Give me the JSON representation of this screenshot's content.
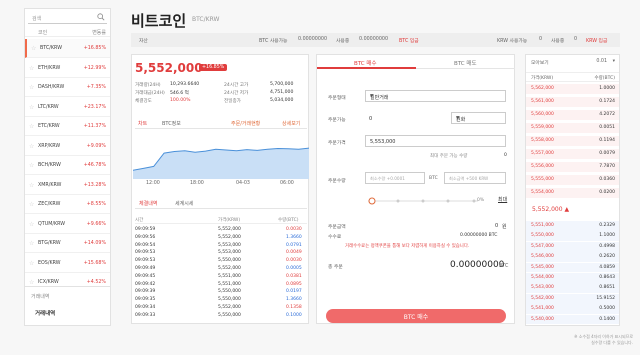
{
  "sidebar": {
    "search_placeholder": "검색",
    "col_coin": "코인",
    "col_change": "변동률",
    "coins": [
      {
        "name": "BTC/KRW",
        "change": "+16.85%"
      },
      {
        "name": "ETH/KRW",
        "change": "+12.99%"
      },
      {
        "name": "DASH/KRW",
        "change": "+7.35%"
      },
      {
        "name": "LTC/KRW",
        "change": "+23.17%"
      },
      {
        "name": "ETC/KRW",
        "change": "+11.37%"
      },
      {
        "name": "XRP/KRW",
        "change": "+9.09%"
      },
      {
        "name": "BCH/KRW",
        "change": "+46.78%"
      },
      {
        "name": "XMR/KRW",
        "change": "+13.28%"
      },
      {
        "name": "ZEC/KRW",
        "change": "+8.55%"
      },
      {
        "name": "QTUM/KRW",
        "change": "+9.66%"
      },
      {
        "name": "BTG/KRW",
        "change": "+14.09%"
      },
      {
        "name": "EOS/KRW",
        "change": "+15.68%"
      },
      {
        "name": "ICX/KRW",
        "change": "+4.52%"
      }
    ],
    "bottom_section": "거래내역",
    "bottom_link": "거래내역"
  },
  "header": {
    "title": "비트코인",
    "subtitle": "BTC/KRW"
  },
  "assets": {
    "label": "자산",
    "btc_avail_label": "BTC 사용가능",
    "btc_avail": "0.00000000",
    "btc_inuse_label": "사용중",
    "btc_inuse": "0.00000000",
    "btc_deposit": "BTC 입금",
    "krw_avail_label": "KRW 사용가능",
    "krw_avail": "0",
    "krw_inuse_label": "사용중",
    "krw_inuse": "0",
    "krw_deposit": "KRW 입금"
  },
  "ticker": {
    "price": "5,552,000",
    "change": "+16.85%",
    "stats": [
      {
        "label": "거래량(24H)",
        "value": "10,293.6640"
      },
      {
        "label": "거래대금(24H)",
        "value": "546.6 억"
      },
      {
        "label": "체결강도",
        "value": "100.00%"
      },
      {
        "label": "24시간 고가",
        "value": "5,700,000"
      },
      {
        "label": "24시간 저가",
        "value": "4,751,000"
      },
      {
        "label": "전일종가",
        "value": "5,034,000"
      }
    ],
    "tab_chart": "차트",
    "tab_info": "BTC정보",
    "link_alert": "주문/거래현황",
    "link_detail": "상세보기",
    "chart_times": [
      "12:00",
      "18:00",
      "04-03",
      "06:00"
    ]
  },
  "trades": {
    "tab_fills": "체결내역",
    "tab_world": "세계시세",
    "col_time": "시간",
    "col_price": "가격(KRW)",
    "col_qty": "수량(BTC)",
    "rows": [
      {
        "time": "09:09:59",
        "price": "5,552,000",
        "qty": "0.0030",
        "dir": "up"
      },
      {
        "time": "09:09:56",
        "price": "5,552,000",
        "qty": "1.3660",
        "dir": "dn"
      },
      {
        "time": "09:09:54",
        "price": "5,553,000",
        "qty": "0.0791",
        "dir": "dn"
      },
      {
        "time": "09:09:53",
        "price": "5,553,000",
        "qty": "0.0049",
        "dir": "up"
      },
      {
        "time": "09:09:53",
        "price": "5,550,000",
        "qty": "0.0030",
        "dir": "up"
      },
      {
        "time": "09:09:49",
        "price": "5,552,000",
        "qty": "0.0005",
        "dir": "dn"
      },
      {
        "time": "09:09:45",
        "price": "5,551,000",
        "qty": "0.0381",
        "dir": "up"
      },
      {
        "time": "09:09:42",
        "price": "5,551,000",
        "qty": "0.0895",
        "dir": "up"
      },
      {
        "time": "09:09:39",
        "price": "5,550,000",
        "qty": "0.0197",
        "dir": "dn"
      },
      {
        "time": "09:09:35",
        "price": "5,550,000",
        "qty": "1.3660",
        "dir": "dn"
      },
      {
        "time": "09:09:34",
        "price": "5,552,000",
        "qty": "0.1358",
        "dir": "up"
      },
      {
        "time": "09:09:33",
        "price": "5,550,000",
        "qty": "0.1000",
        "dir": "dn"
      }
    ]
  },
  "order": {
    "tab_buy": "BTC 매수",
    "tab_sell": "BTC 매도",
    "type_label": "주문형태",
    "type_value": "일반거래",
    "avail_label": "주문가능",
    "avail_value": "0",
    "avail_unit": "원화",
    "price_label": "주문가격",
    "price_value": "5,553,000",
    "min_label": "최대 주문 가능 수량",
    "min_value": "0",
    "qty_label": "주문수량",
    "qty_ph1": "최소수량 +0.0001",
    "qty_unit": "BTC",
    "qty_ph2": "최소금액 +500 KRW",
    "slider_pct": "0%",
    "max": "최대",
    "total_label": "주문금액",
    "total_value": "0",
    "total_unit": "원",
    "fee_label": "수수료",
    "fee_value": "0.00000000 BTC",
    "warn": "거래수수료는 정액쿠폰을 통해 보다 저렴하게 이용하실 수 있습니다.",
    "sum_label": "총 주문",
    "sum_value": "0.00000000",
    "sum_unit": "BTC",
    "button": "BTC 매수"
  },
  "orderbook": {
    "title": "모아보기",
    "precision": "0.01",
    "col_price": "가격(KRW)",
    "col_qty": "수량(BTC)",
    "asks": [
      {
        "p": "5,562,000",
        "q": "1.0000"
      },
      {
        "p": "5,561,000",
        "q": "0.1724"
      },
      {
        "p": "5,560,000",
        "q": "4.2072"
      },
      {
        "p": "5,559,000",
        "q": "0.0051"
      },
      {
        "p": "5,558,000",
        "q": "0.1194"
      },
      {
        "p": "5,557,000",
        "q": "0.0079"
      },
      {
        "p": "5,556,000",
        "q": "7.7870"
      },
      {
        "p": "5,555,000",
        "q": "0.0360"
      },
      {
        "p": "5,554,000",
        "q": "0.0200"
      }
    ],
    "mid_price": "5,552,000 ▲",
    "bids": [
      {
        "p": "5,551,000",
        "q": "0.2329"
      },
      {
        "p": "5,550,000",
        "q": "1.1000"
      },
      {
        "p": "5,547,000",
        "q": "0.4998"
      },
      {
        "p": "5,546,000",
        "q": "0.2620"
      },
      {
        "p": "5,545,000",
        "q": "4.0859"
      },
      {
        "p": "5,544,000",
        "q": "0.8643"
      },
      {
        "p": "5,543,000",
        "q": "0.8651"
      },
      {
        "p": "5,542,000",
        "q": "15.9152"
      },
      {
        "p": "5,541,000",
        "q": "0.5000"
      },
      {
        "p": "5,540,000",
        "q": "0.1400"
      }
    ],
    "footnote_1": "※ 소수점 4자리 이하가 표시되므로",
    "footnote_2": "실수량 다를 수 있습니다."
  },
  "colors": {
    "up": "#e03c3c",
    "down": "#2a6bd8",
    "accent": "#f06a6a"
  },
  "chart_points": [
    0.15,
    0.2,
    0.25,
    0.6,
    0.64,
    0.66,
    0.62,
    0.65,
    0.7,
    0.68,
    0.66,
    0.69,
    0.67,
    0.7,
    0.72,
    0.71,
    0.7,
    0.73
  ]
}
